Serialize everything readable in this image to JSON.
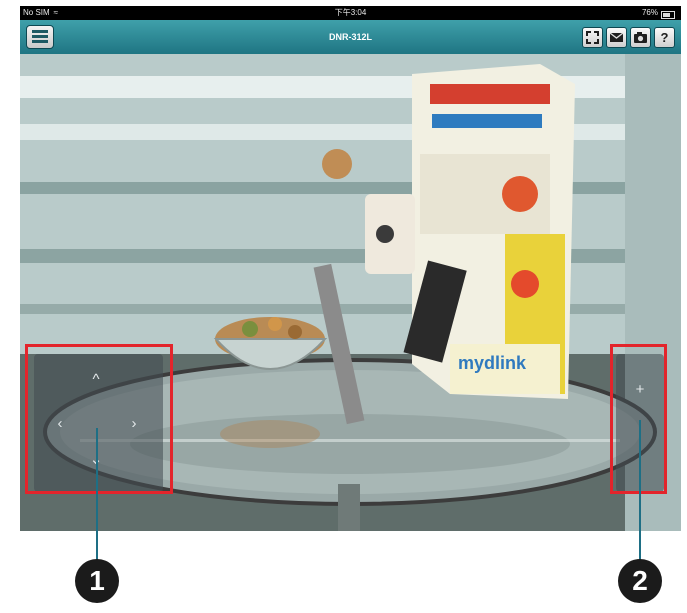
{
  "status_bar": {
    "carrier": "No SIM",
    "time": "下午3:04",
    "battery": "76%"
  },
  "nav_bar": {
    "title": "DNR-312L",
    "help_label": "?"
  },
  "camera_view": {
    "product_text": "mydlink"
  },
  "ptz_pad": {
    "up": "^",
    "left": "‹",
    "right": "›",
    "down": "⌄"
  },
  "zoom_pad": {
    "zoom_in": "+"
  },
  "callouts": [
    "1",
    "2"
  ],
  "colors": {
    "nav_bar": "#2c8b97",
    "highlight": "#e3242b",
    "callout": "#1b1b1b",
    "callout_line": "#1e6f85"
  }
}
